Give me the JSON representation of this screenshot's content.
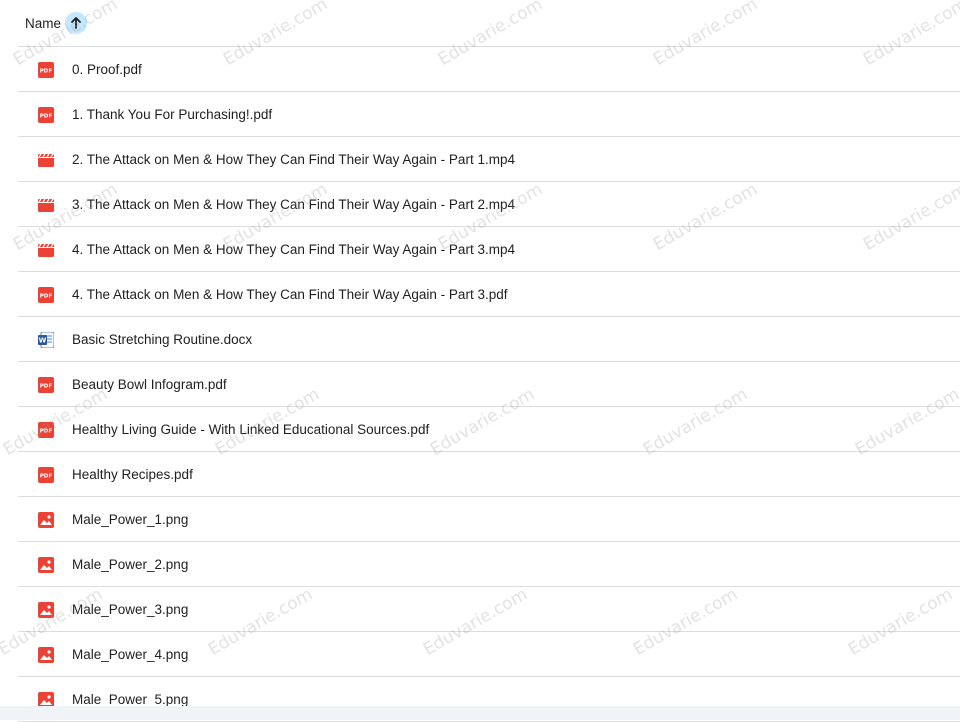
{
  "header": {
    "name_label": "Name",
    "sort_icon": "arrow-up-icon"
  },
  "files": [
    {
      "name": "0. Proof.pdf",
      "type": "pdf"
    },
    {
      "name": "1. Thank You For Purchasing!.pdf",
      "type": "pdf"
    },
    {
      "name": "2. The Attack on Men & How They Can Find Their Way Again - Part 1.mp4",
      "type": "video"
    },
    {
      "name": "3. The Attack on Men & How They Can Find Their Way Again - Part 2.mp4",
      "type": "video"
    },
    {
      "name": "4. The Attack on Men & How They Can Find Their Way Again - Part 3.mp4",
      "type": "video"
    },
    {
      "name": "4. The Attack on Men & How They Can Find Their Way Again - Part 3.pdf",
      "type": "pdf"
    },
    {
      "name": "Basic Stretching Routine.docx",
      "type": "word"
    },
    {
      "name": "Beauty Bowl Infogram.pdf",
      "type": "pdf"
    },
    {
      "name": "Healthy Living Guide - With Linked Educational Sources.pdf",
      "type": "pdf"
    },
    {
      "name": "Healthy Recipes.pdf",
      "type": "pdf"
    },
    {
      "name": "Male_Power_1.png",
      "type": "image"
    },
    {
      "name": "Male_Power_2.png",
      "type": "image"
    },
    {
      "name": "Male_Power_3.png",
      "type": "image"
    },
    {
      "name": "Male_Power_4.png",
      "type": "image"
    },
    {
      "name": "Male_Power_5.png",
      "type": "image"
    }
  ],
  "icons": {
    "pdf": "pdf-icon",
    "video": "video-icon",
    "word": "word-doc-icon",
    "image": "image-icon"
  },
  "colors": {
    "pdf": "#ea4335",
    "video": "#ea4335",
    "word": "#4285f4",
    "image": "#ea4335",
    "sort_highlight": "#c2e7ff"
  },
  "watermark": "Eduvarie.com"
}
